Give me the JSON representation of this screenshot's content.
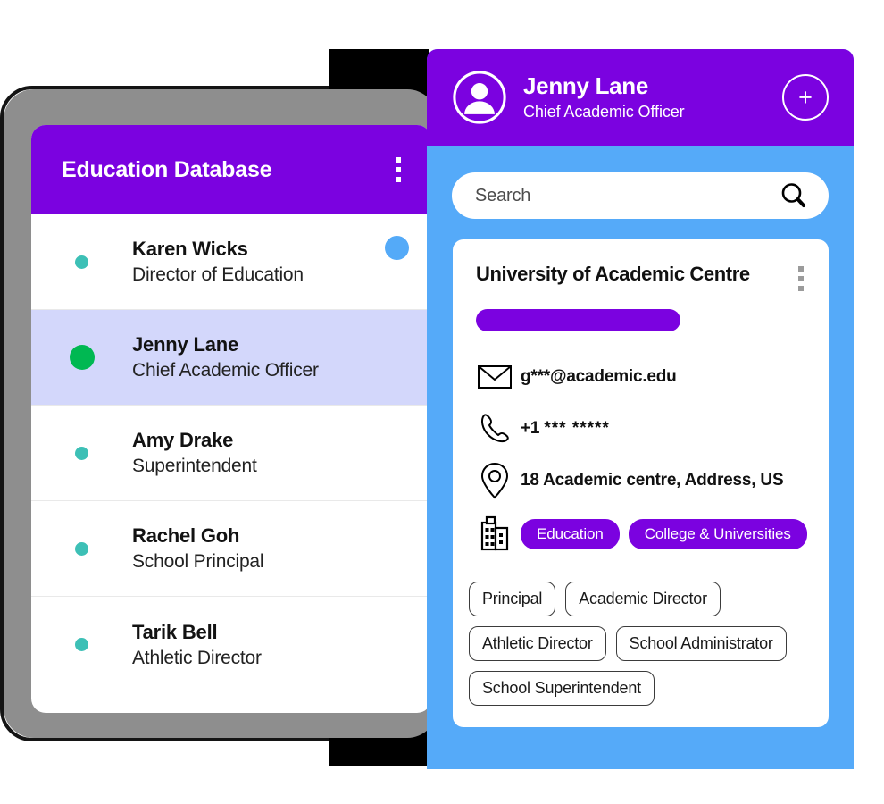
{
  "left_panel": {
    "title": "Education Database",
    "menu_icon": "kebab-menu-icon",
    "status_marker": "blue-dot-marker",
    "people": [
      {
        "name": "Karen Wicks",
        "role": "Director of Education",
        "status": "teal",
        "selected": false
      },
      {
        "name": "Jenny Lane",
        "role": "Chief Academic Officer",
        "status": "green",
        "selected": true
      },
      {
        "name": "Amy Drake",
        "role": "Superintendent",
        "status": "teal",
        "selected": false
      },
      {
        "name": "Rachel Goh",
        "role": "School Principal",
        "status": "teal",
        "selected": false
      },
      {
        "name": "Tarik Bell",
        "role": "Athletic Director",
        "status": "teal",
        "selected": false
      }
    ]
  },
  "right_panel": {
    "header": {
      "avatar_icon": "user-avatar-icon",
      "name": "Jenny Lane",
      "role": "Chief Academic Officer",
      "add_label": "+"
    },
    "search": {
      "placeholder": "Search",
      "icon": "search-icon"
    },
    "detail_card": {
      "org_name": "University of Academic Centre",
      "menu_icon": "kebab-menu-icon",
      "redacted_bar": "",
      "email": "g***@academic.edu",
      "phone_prefix": "+1",
      "phone_masked": "*** *****",
      "address": "18 Academic centre, Address, US",
      "tags": [
        "Education",
        "College & Universities"
      ],
      "role_chips": [
        "Principal",
        "Academic Director",
        "Athletic Director",
        "School Administrator",
        "School Superintendent"
      ]
    }
  },
  "colors": {
    "purple": "#7b02e0",
    "blue": "#55aaf9",
    "teal": "#3dc0b6",
    "green": "#00b852",
    "selected_row": "#d3d7fb",
    "frame_gray": "#8e8e8e"
  }
}
